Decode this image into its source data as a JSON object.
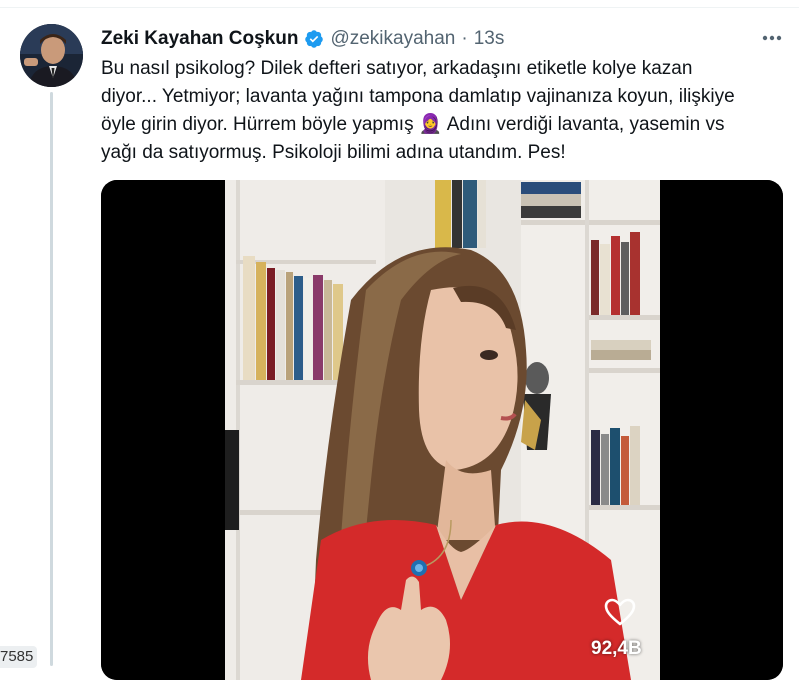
{
  "tweet": {
    "author_name": "Zeki Kayahan Coşkun",
    "author_handle": "@zekikayahan",
    "separator": "·",
    "timestamp": "13s",
    "text_line_1": "Bu nasıl psikolog? Dilek defteri satıyor, arkadaşını etiketle kolye kazan",
    "text_line_2": "diyor... Yetmiyor; lavanta yağını tampona damlatıp vajinanıza koyun, ilişkiye",
    "text_line_3_before": "öyle girin diyor. Hürrem böyle yapmış ",
    "emoji": "🧕",
    "text_line_3_after": " Adını verdiği lavanta, yasemin vs",
    "text_line_4": "yağı da satıyormuş. Psikoloji bilimi adına utandım. Pes!",
    "more_icon": "more-horizontal-icon",
    "verified_icon": "verified-badge-icon",
    "verified_color": "#1d9bf0"
  },
  "media": {
    "type": "video",
    "view_count": "92,4B",
    "like_icon": "heart-icon"
  },
  "sidebar": {
    "partial_count": "7585"
  }
}
